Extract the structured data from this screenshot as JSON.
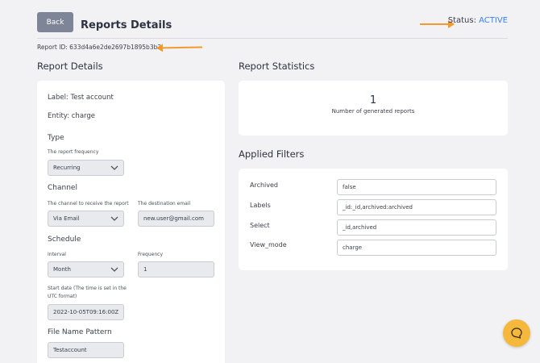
{
  "header": {
    "back_label": "Back",
    "title": "Reports Details",
    "status_label": "Status:",
    "status_value": "ACTIVE",
    "report_id": "Report ID: 633d4a6e2de2697b1895b3b2"
  },
  "details": {
    "section_title": "Report Details",
    "label": "Label: Test account",
    "entity": "Entity: charge",
    "type_heading": "Type",
    "frequency_label": "The report frequency",
    "frequency_value": "Recurring",
    "channel_heading": "Channel",
    "channel_label": "The channel to receive the report",
    "channel_value": "Via Email",
    "email_label": "The destination email",
    "email_value": "new.user@gmail.com",
    "schedule_heading": "Schedule",
    "interval_label": "Interval",
    "interval_value": "Month",
    "frequency_num_label": "Frequency",
    "frequency_num_value": "1",
    "start_date_label_1": "Start date (The time is set in the",
    "start_date_label_2": "UTC format)",
    "start_date_value": "2022-10-05T09:16:00Z",
    "file_name_heading": "File Name Pattern",
    "file_name_value": "Testaccount"
  },
  "statistics": {
    "section_title": "Report Statistics",
    "count": "1",
    "count_label": "Number of generated reports"
  },
  "filters": {
    "section_title": "Applied Filters",
    "items": [
      {
        "label": "Archived",
        "value": "false"
      },
      {
        "label": "Labels",
        "value": "_id:_id,archived:archived"
      },
      {
        "label": "Select",
        "value": "_id,archived"
      },
      {
        "label": "View_mode",
        "value": "charge"
      }
    ]
  },
  "colors": {
    "accent": "#3b82f6",
    "annotation_arrow": "#f29a2e",
    "chat_button": "#f5b83d",
    "back_button": "#7d8597"
  },
  "icons": {
    "chevron": "chevron-down-icon",
    "chat": "chat-bubble-icon"
  }
}
